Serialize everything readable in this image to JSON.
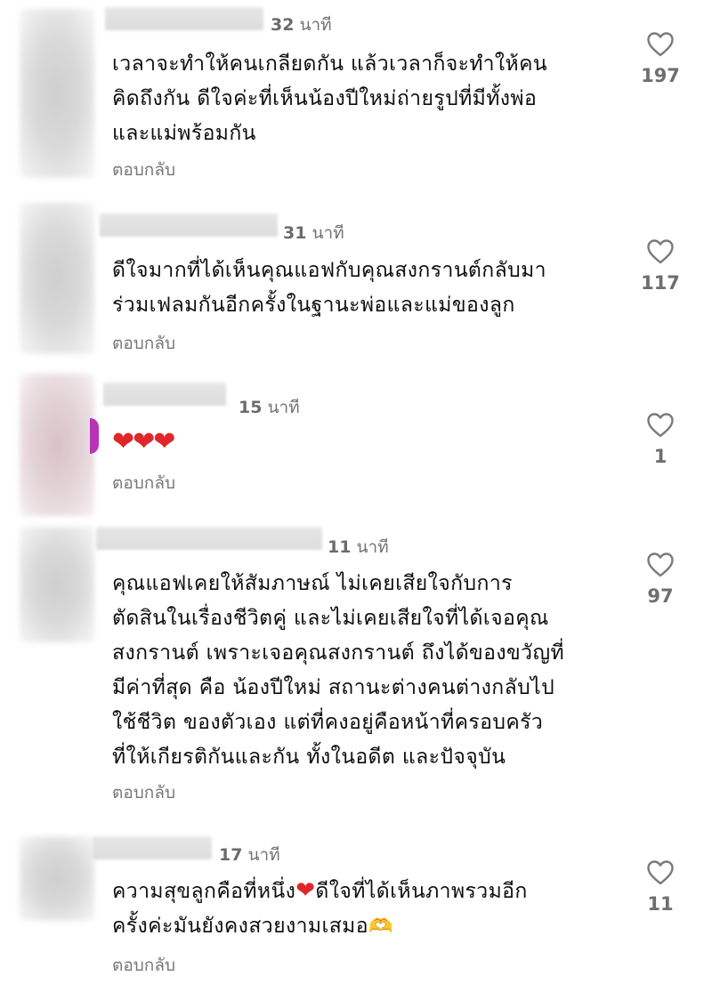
{
  "comments": [
    {
      "time_num": "32",
      "time_unit": "นาที",
      "line1": "เวลาจะทำให้คนเกลียดกัน  แล้วเวลาก็จะทำให้คน",
      "line2": "คิดถึงกัน  ดีใจค่ะที่เห็นน้องปีใหม่ถ่ายรูปที่มีทั้งพ่อ",
      "line3": "และแม่พร้อมกัน",
      "reply": "ตอบกลับ",
      "likes": "197"
    },
    {
      "time_num": "31",
      "time_unit": "นาที",
      "line1": "ดีใจมากที่ได้เห็นคุณแอฟกับคุณสงกรานต์กลับมา",
      "line2": "ร่วมเฟลมกันอีกครั้งในฐานะพ่อและแม่ของลูก",
      "reply": "ตอบกลับ",
      "likes": "117"
    },
    {
      "time_num": "15",
      "time_unit": "นาที",
      "hearts": "❤❤❤",
      "reply": "ตอบกลับ",
      "likes": "1"
    },
    {
      "time_num": "11",
      "time_unit": "นาที",
      "line1": "คุณแอฟเคยให้สัมภาษณ์  ไม่เคยเสียใจกับการ",
      "line2": "ตัดสินในเรื่องชีวิตคู่ และไม่เคยเสียใจที่ได้เจอคุณ",
      "line3": "สงกรานต์ เพราะเจอคุณสงกรานต์ ถึงได้ของขวัญที่",
      "line4": "มีค่าที่สุด คือ น้องปีใหม่  สถานะต่างคนต่างกลับไป",
      "line5": "ใช้ชีวิต ของตัวเอง  แต่ที่คงอยู่คือหน้าที่ครอบครัว",
      "line6": "ที่ให้เกียรติกันและกัน ทั้งในอดีต และปัจจุบัน",
      "reply": "ตอบกลับ",
      "likes": "97"
    },
    {
      "time_num": "17",
      "time_unit": "นาที",
      "line1_a": "ความสุขลูกคือที่หนึ่ง",
      "line1_emoji": "❤",
      "line1_b": "ดีใจที่ได้เห็นภาพรวมอีก",
      "line2_a": "ครั้งค่ะมันยังคงสวยงามเสมอ",
      "line2_emoji": "🫶",
      "reply": "ตอบกลับ",
      "likes": "11"
    }
  ],
  "icons": {
    "like": "heart-outline-icon",
    "heart_emoji": "red-heart-emoji",
    "hand_heart_emoji": "heart-hands-emoji"
  },
  "colors": {
    "text": "#0e0e0e",
    "meta": "#737373",
    "heart": "#e0262b",
    "story_ring": "#b833b6"
  }
}
